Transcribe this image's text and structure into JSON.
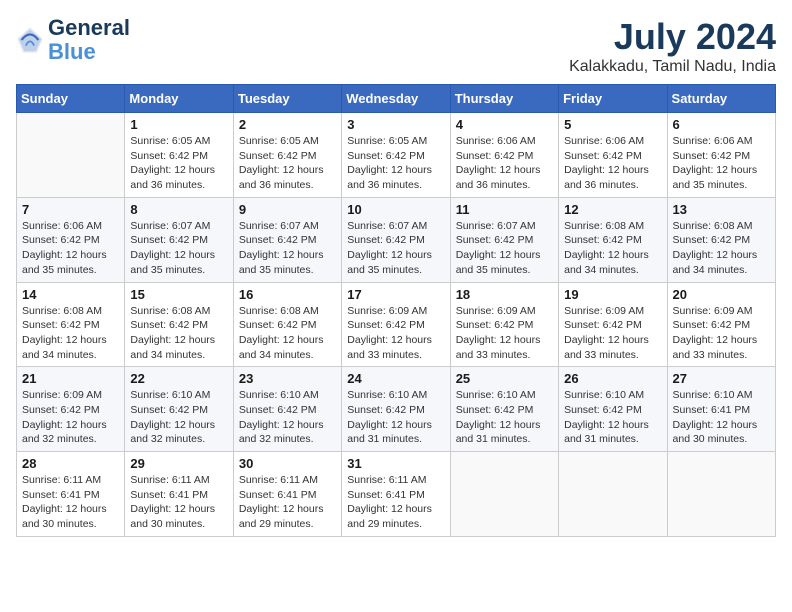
{
  "header": {
    "logo_line1": "General",
    "logo_line2": "Blue",
    "month_year": "July 2024",
    "location": "Kalakkadu, Tamil Nadu, India"
  },
  "weekdays": [
    "Sunday",
    "Monday",
    "Tuesday",
    "Wednesday",
    "Thursday",
    "Friday",
    "Saturday"
  ],
  "weeks": [
    [
      {
        "day": "",
        "sunrise": "",
        "sunset": "",
        "daylight": ""
      },
      {
        "day": "1",
        "sunrise": "6:05 AM",
        "sunset": "6:42 PM",
        "daylight": "12 hours and 36 minutes."
      },
      {
        "day": "2",
        "sunrise": "6:05 AM",
        "sunset": "6:42 PM",
        "daylight": "12 hours and 36 minutes."
      },
      {
        "day": "3",
        "sunrise": "6:05 AM",
        "sunset": "6:42 PM",
        "daylight": "12 hours and 36 minutes."
      },
      {
        "day": "4",
        "sunrise": "6:06 AM",
        "sunset": "6:42 PM",
        "daylight": "12 hours and 36 minutes."
      },
      {
        "day": "5",
        "sunrise": "6:06 AM",
        "sunset": "6:42 PM",
        "daylight": "12 hours and 36 minutes."
      },
      {
        "day": "6",
        "sunrise": "6:06 AM",
        "sunset": "6:42 PM",
        "daylight": "12 hours and 35 minutes."
      }
    ],
    [
      {
        "day": "7",
        "sunrise": "6:06 AM",
        "sunset": "6:42 PM",
        "daylight": "12 hours and 35 minutes."
      },
      {
        "day": "8",
        "sunrise": "6:07 AM",
        "sunset": "6:42 PM",
        "daylight": "12 hours and 35 minutes."
      },
      {
        "day": "9",
        "sunrise": "6:07 AM",
        "sunset": "6:42 PM",
        "daylight": "12 hours and 35 minutes."
      },
      {
        "day": "10",
        "sunrise": "6:07 AM",
        "sunset": "6:42 PM",
        "daylight": "12 hours and 35 minutes."
      },
      {
        "day": "11",
        "sunrise": "6:07 AM",
        "sunset": "6:42 PM",
        "daylight": "12 hours and 35 minutes."
      },
      {
        "day": "12",
        "sunrise": "6:08 AM",
        "sunset": "6:42 PM",
        "daylight": "12 hours and 34 minutes."
      },
      {
        "day": "13",
        "sunrise": "6:08 AM",
        "sunset": "6:42 PM",
        "daylight": "12 hours and 34 minutes."
      }
    ],
    [
      {
        "day": "14",
        "sunrise": "6:08 AM",
        "sunset": "6:42 PM",
        "daylight": "12 hours and 34 minutes."
      },
      {
        "day": "15",
        "sunrise": "6:08 AM",
        "sunset": "6:42 PM",
        "daylight": "12 hours and 34 minutes."
      },
      {
        "day": "16",
        "sunrise": "6:08 AM",
        "sunset": "6:42 PM",
        "daylight": "12 hours and 34 minutes."
      },
      {
        "day": "17",
        "sunrise": "6:09 AM",
        "sunset": "6:42 PM",
        "daylight": "12 hours and 33 minutes."
      },
      {
        "day": "18",
        "sunrise": "6:09 AM",
        "sunset": "6:42 PM",
        "daylight": "12 hours and 33 minutes."
      },
      {
        "day": "19",
        "sunrise": "6:09 AM",
        "sunset": "6:42 PM",
        "daylight": "12 hours and 33 minutes."
      },
      {
        "day": "20",
        "sunrise": "6:09 AM",
        "sunset": "6:42 PM",
        "daylight": "12 hours and 33 minutes."
      }
    ],
    [
      {
        "day": "21",
        "sunrise": "6:09 AM",
        "sunset": "6:42 PM",
        "daylight": "12 hours and 32 minutes."
      },
      {
        "day": "22",
        "sunrise": "6:10 AM",
        "sunset": "6:42 PM",
        "daylight": "12 hours and 32 minutes."
      },
      {
        "day": "23",
        "sunrise": "6:10 AM",
        "sunset": "6:42 PM",
        "daylight": "12 hours and 32 minutes."
      },
      {
        "day": "24",
        "sunrise": "6:10 AM",
        "sunset": "6:42 PM",
        "daylight": "12 hours and 31 minutes."
      },
      {
        "day": "25",
        "sunrise": "6:10 AM",
        "sunset": "6:42 PM",
        "daylight": "12 hours and 31 minutes."
      },
      {
        "day": "26",
        "sunrise": "6:10 AM",
        "sunset": "6:42 PM",
        "daylight": "12 hours and 31 minutes."
      },
      {
        "day": "27",
        "sunrise": "6:10 AM",
        "sunset": "6:41 PM",
        "daylight": "12 hours and 30 minutes."
      }
    ],
    [
      {
        "day": "28",
        "sunrise": "6:11 AM",
        "sunset": "6:41 PM",
        "daylight": "12 hours and 30 minutes."
      },
      {
        "day": "29",
        "sunrise": "6:11 AM",
        "sunset": "6:41 PM",
        "daylight": "12 hours and 30 minutes."
      },
      {
        "day": "30",
        "sunrise": "6:11 AM",
        "sunset": "6:41 PM",
        "daylight": "12 hours and 29 minutes."
      },
      {
        "day": "31",
        "sunrise": "6:11 AM",
        "sunset": "6:41 PM",
        "daylight": "12 hours and 29 minutes."
      },
      {
        "day": "",
        "sunrise": "",
        "sunset": "",
        "daylight": ""
      },
      {
        "day": "",
        "sunrise": "",
        "sunset": "",
        "daylight": ""
      },
      {
        "day": "",
        "sunrise": "",
        "sunset": "",
        "daylight": ""
      }
    ]
  ],
  "labels": {
    "sunrise_prefix": "Sunrise: ",
    "sunset_prefix": "Sunset: ",
    "daylight_prefix": "Daylight: "
  }
}
